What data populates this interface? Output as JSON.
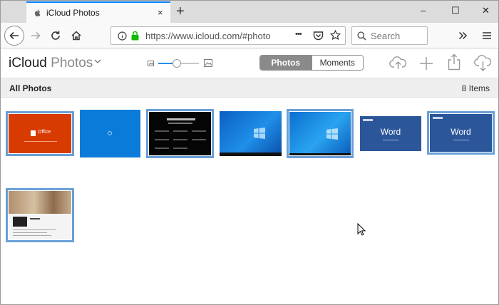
{
  "browser": {
    "tab_title": "iCloud Photos",
    "tab_close": "×",
    "new_tab": "+",
    "window_controls": {
      "minimize": "–",
      "maximize": "☐",
      "close": "✕"
    },
    "url": "https://www.icloud.com/#photo",
    "url_more": "•••",
    "search_placeholder": "Search"
  },
  "app": {
    "brand": "iCloud",
    "name": "Photos",
    "segments": {
      "photos": "Photos",
      "moments": "Moments"
    },
    "active_segment": "photos",
    "zoom_slider_level": 0.45
  },
  "subheader": {
    "title": "All Photos",
    "count": "8 Items"
  },
  "photos": [
    {
      "kind": "office",
      "label": "Office",
      "selected": true
    },
    {
      "kind": "blue-boot",
      "selected": false
    },
    {
      "kind": "dark-settings",
      "selected": true
    },
    {
      "kind": "windows-desktop",
      "selected": false
    },
    {
      "kind": "windows-desktop",
      "selected": true
    },
    {
      "kind": "word",
      "label": "Word",
      "selected": false
    },
    {
      "kind": "word",
      "label": "Word",
      "selected": true
    },
    {
      "kind": "web-page",
      "selected": true
    }
  ],
  "colors": {
    "selection": "#6a9fd8",
    "office_orange": "#d83b01",
    "word_blue": "#2b579a",
    "windows_blue": "#0a7bd8",
    "tab_accent": "#0a84ff"
  }
}
